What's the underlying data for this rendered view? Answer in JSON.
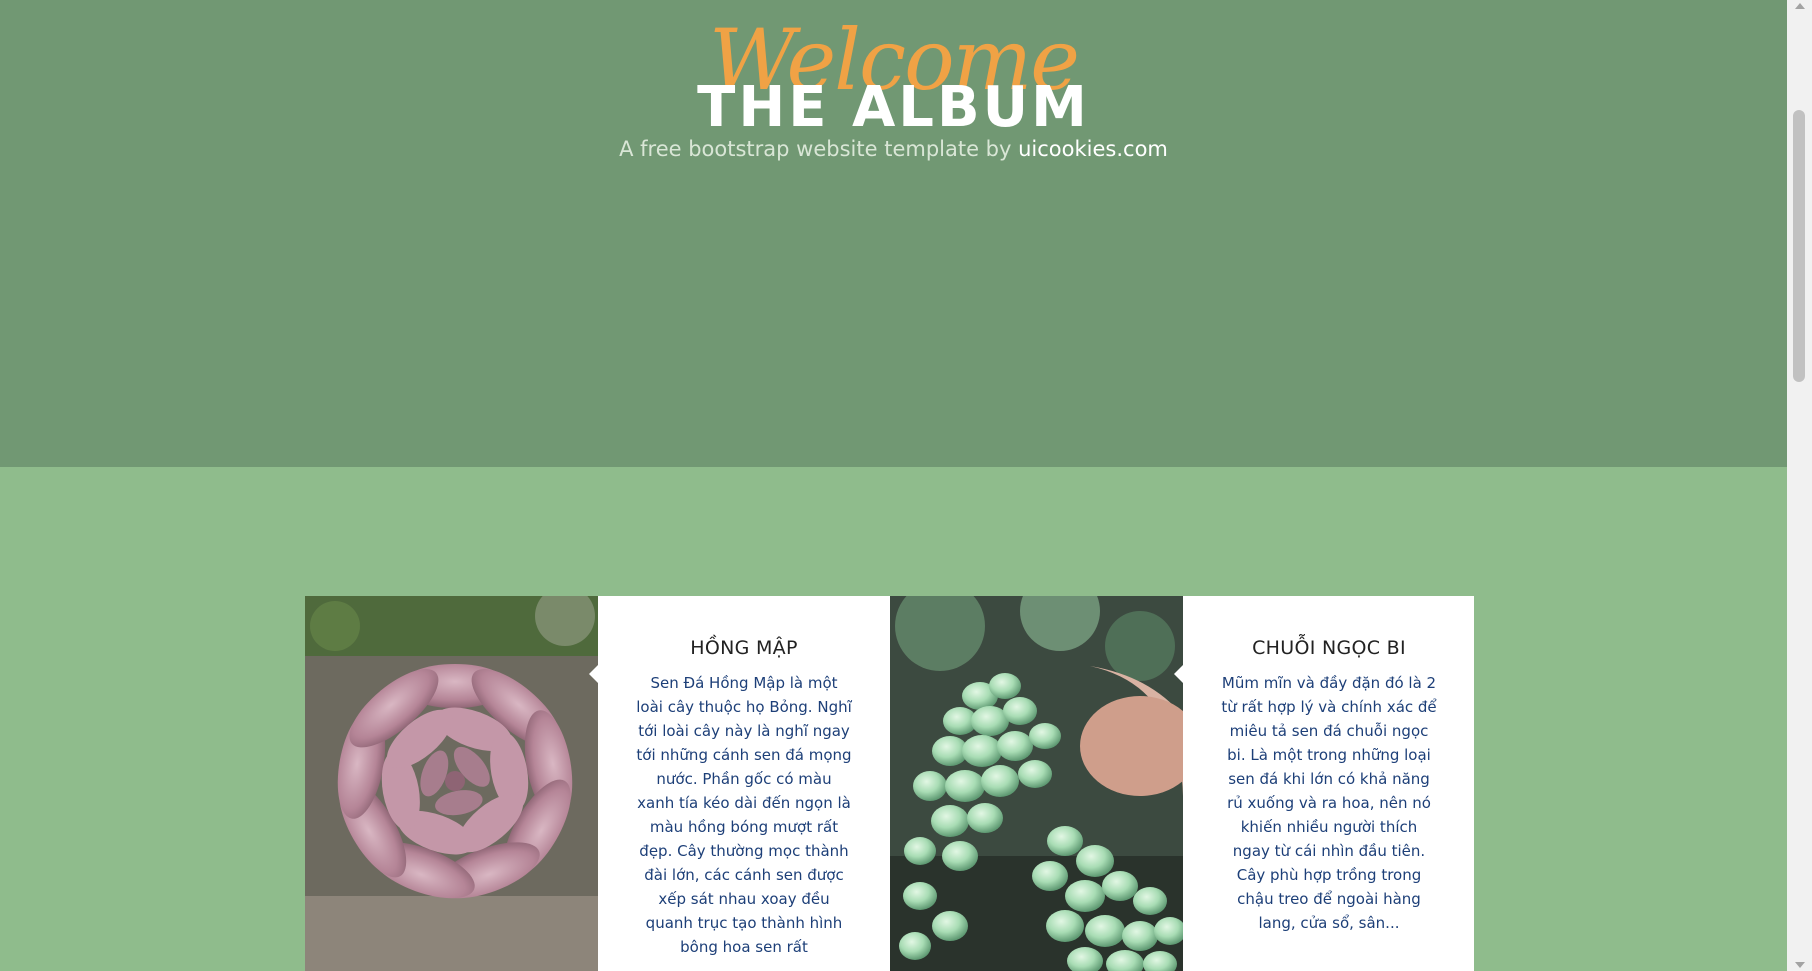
{
  "hero": {
    "welcome": "Welcome",
    "title": "THE ALBUM",
    "subtitle_prefix": "A free bootstrap website template by ",
    "subtitle_link": "uicookies.com"
  },
  "cards": [
    {
      "title": "HỒNG MẬP",
      "image_alt": "Sen đá hồng mập",
      "description": "Sen Đá Hồng Mập là một loài cây thuộc họ Bỏng. Nghĩ tới loài cây này là nghĩ ngay tới những cánh sen đá mọng nước. Phần gốc có màu xanh tía kéo dài đến ngọn là màu hồng bóng mượt rất đẹp. Cây thường mọc thành đài lớn, các cánh sen được xếp sát nhau xoay đều quanh trục tạo thành hình bông hoa sen rất"
    },
    {
      "title": "CHUỖI NGỌC BI",
      "image_alt": "Sen đá chuỗi ngọc bi",
      "description": "Mũm mĩn và đầy đặn đó là 2 từ rất hợp lý và chính xác để miêu tả sen đá chuỗi ngọc bi. Là một trong những loại sen đá khi lớn có khả năng rủ xuống và ra hoa, nên nó khiến nhiều người thích ngay từ cái nhìn đầu tiên. Cây phù hợp trồng trong chậu treo để ngoài hàng lang, cửa sổ, sân..."
    }
  ],
  "colors": {
    "hero_bg": "#719873",
    "section_bg": "#8fbc8c",
    "welcome": "#f0a245",
    "card_text": "#1d3f78"
  }
}
